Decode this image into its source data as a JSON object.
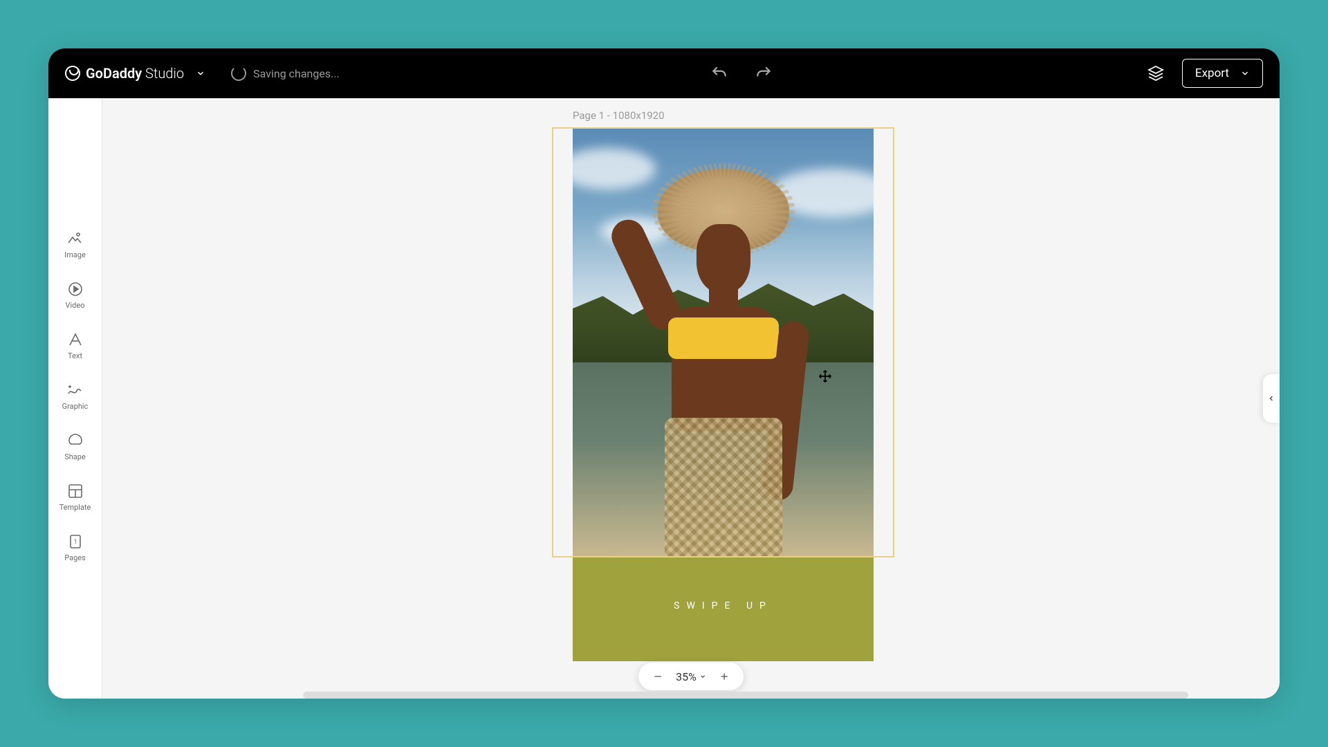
{
  "app": {
    "brand_bold": "GoDaddy",
    "brand_light": " Studio"
  },
  "status": {
    "saving": "Saving changes..."
  },
  "topbar": {
    "export_label": "Export"
  },
  "left_tools": [
    {
      "key": "image",
      "label": "Image"
    },
    {
      "key": "video",
      "label": "Video"
    },
    {
      "key": "text",
      "label": "Text"
    },
    {
      "key": "graphic",
      "label": "Graphic"
    },
    {
      "key": "shape",
      "label": "Shape"
    },
    {
      "key": "template",
      "label": "Template"
    },
    {
      "key": "pages",
      "label": "Pages"
    }
  ],
  "canvas": {
    "page_label": "Page 1 - 1080x1920",
    "swipe_text": "SWIPE UP",
    "colors": {
      "footer_bg": "#a0a23e",
      "garment": "#f2c233"
    }
  },
  "zoom": {
    "value": "35%"
  }
}
